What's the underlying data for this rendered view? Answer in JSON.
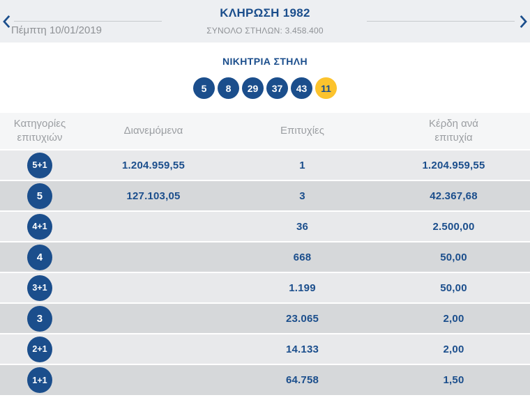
{
  "header": {
    "title": "ΚΛΗΡΩΣΗ 1982",
    "subtitle": "ΣΥΝΟΛΟ ΣΤΗΛΩΝ: 3.458.400",
    "date": "Πέμπτη 10/01/2019"
  },
  "winning": {
    "title": "ΝΙΚΗΤΡΙΑ ΣΤΗΛΗ",
    "numbers": [
      {
        "value": "5",
        "type": "main"
      },
      {
        "value": "8",
        "type": "main"
      },
      {
        "value": "29",
        "type": "main"
      },
      {
        "value": "37",
        "type": "main"
      },
      {
        "value": "43",
        "type": "main"
      },
      {
        "value": "11",
        "type": "bonus"
      }
    ]
  },
  "table": {
    "headers": [
      {
        "key": "category",
        "label": "Κατηγορίες επιτυχιών"
      },
      {
        "key": "dianemomena",
        "label": "Διανεμόμενα"
      },
      {
        "key": "epityxies",
        "label": "Επιτυχίες"
      },
      {
        "key": "kerdi",
        "label": "Κέρδη ανά επιτυχία"
      }
    ],
    "rows": [
      {
        "category": "5+1",
        "dianemomena": "1.204.959,55",
        "epityxies": "1",
        "kerdi": "1.204.959,55"
      },
      {
        "category": "5",
        "dianemomena": "127.103,05",
        "epityxies": "3",
        "kerdi": "42.367,68"
      },
      {
        "category": "4+1",
        "dianemomena": "",
        "epityxies": "36",
        "kerdi": "2.500,00"
      },
      {
        "category": "4",
        "dianemomena": "",
        "epityxies": "668",
        "kerdi": "50,00"
      },
      {
        "category": "3+1",
        "dianemomena": "",
        "epityxies": "1.199",
        "kerdi": "50,00"
      },
      {
        "category": "3",
        "dianemomena": "",
        "epityxies": "23.065",
        "kerdi": "2,00"
      },
      {
        "category": "2+1",
        "dianemomena": "",
        "epityxies": "14.133",
        "kerdi": "2,00"
      },
      {
        "category": "1+1",
        "dianemomena": "",
        "epityxies": "64.758",
        "kerdi": "1,50"
      }
    ]
  },
  "colors": {
    "navy": "#1B4E8C",
    "bonus_yellow": "#FCC32D",
    "row_light": "#E8E9EB",
    "row_dark": "#D6D8DA",
    "table_header_bg": "#F5F6F7",
    "topbar_bg": "#EDEFF2",
    "muted_text": "#8F9296",
    "table_header_text": "#9B9EA2",
    "divider_line": "#C7CBCE"
  }
}
